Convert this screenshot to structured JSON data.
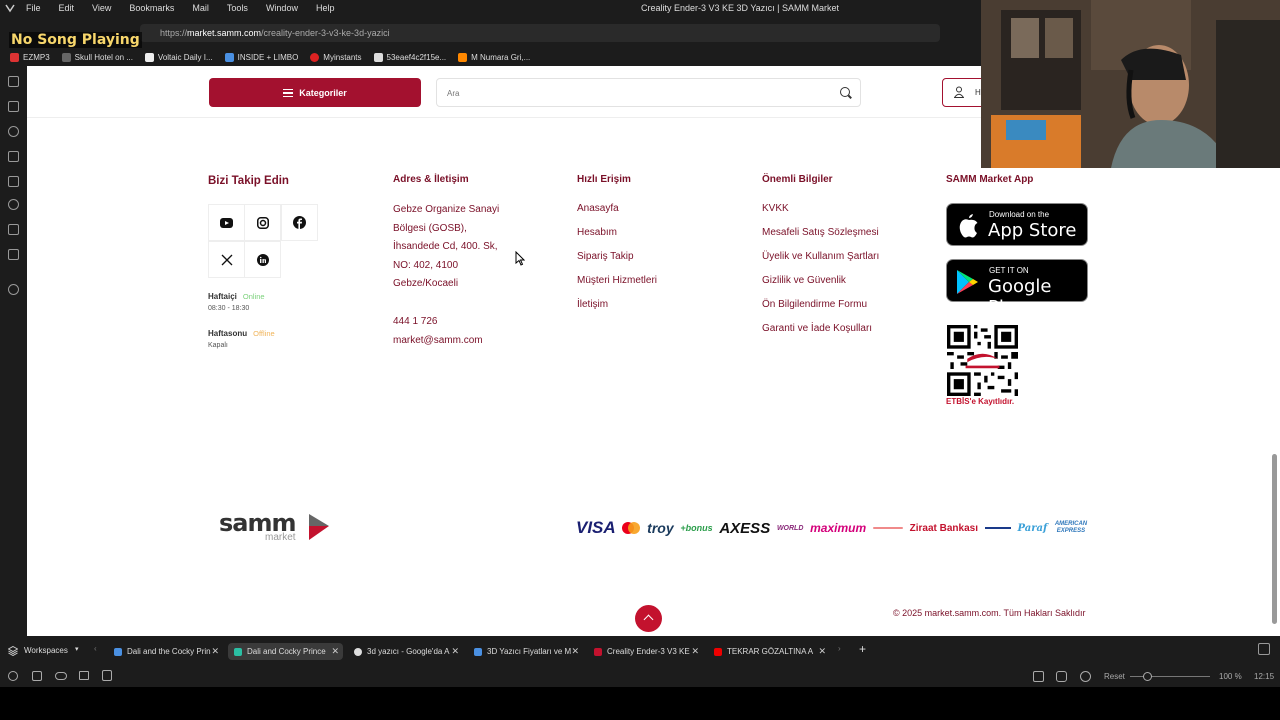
{
  "menubar": {
    "items": [
      "File",
      "Edit",
      "View",
      "Bookmarks",
      "Mail",
      "Tools",
      "Window",
      "Help"
    ],
    "window_title": "Creality Ender-3 V3 KE 3D Yazıcı | SAMM Market"
  },
  "overlay": {
    "now_playing": "No Song Playing"
  },
  "address": {
    "url_prefix": "https://",
    "url_host": "market.samm.com",
    "url_path": "/creality-ender-3-v3-ke-3d-yazici"
  },
  "bookmarks": [
    {
      "label": "EZMP3",
      "color": "#d33"
    },
    {
      "label": "Skull Hotel on ...",
      "color": "#333"
    },
    {
      "label": "Voltaic Daily I...",
      "color": "#fff"
    },
    {
      "label": "INSIDE + LIMBO",
      "color": "#4a90e2"
    },
    {
      "label": "Myinstants",
      "color": "#d22"
    },
    {
      "label": "53eaef4c2f15e...",
      "color": "#ddd"
    },
    {
      "label": "M Numara Gri,...",
      "color": "#f80"
    }
  ],
  "header": {
    "categories_label": "Kategoriler",
    "search_placeholder": "Ara",
    "login_label": "H"
  },
  "footer": {
    "follow_title": "Bizi Takip Edin",
    "social": [
      "youtube-icon",
      "instagram-icon",
      "facebook-icon",
      "x-icon",
      "linkedin-icon"
    ],
    "weekday_label": "Haftaiçi",
    "weekday_status": "Online",
    "weekday_hours": "08:30 - 18:30",
    "weekend_label": "Haftasonu",
    "weekend_status": "Offline",
    "weekend_hours": "Kapalı",
    "address_title": "Adres & İletişim",
    "address_lines": [
      "Gebze Organize Sanayi",
      "Bölgesi (GOSB),",
      "İhsandede Cd, 400. Sk,",
      "NO: 402, 4100",
      "Gebze/Kocaeli"
    ],
    "phone": "444 1 726",
    "email": "market@samm.com",
    "quick_title": "Hızlı Erişim",
    "quick_links": [
      "Anasayfa",
      "Hesabım",
      "Sipariş Takip",
      "Müşteri Hizmetleri",
      "İletişim"
    ],
    "info_title": "Önemli Bilgiler",
    "info_links": [
      "KVKK",
      "Mesafeli Satış Sözleşmesi",
      "Üyelik ve Kullanım Şartları",
      "Gizlilik ve Güvenlik",
      "Ön Bilgilendirme Formu",
      "Garanti ve İade Koşulları"
    ],
    "app_title": "SAMM Market App",
    "appstore_small": "Download on the",
    "appstore_big": "App Store",
    "googleplay_small": "GET IT ON",
    "googleplay_big": "Google Play",
    "etbis_label": "ETBİS'e Kayıtlıdır.",
    "logo_word": "samm",
    "logo_sub": "market",
    "payments": [
      "VISA",
      "troy",
      "+bonus",
      "AXESS",
      "WORLD",
      "maximum",
      "Ziraat Bankası",
      "Paraf",
      "AMERICAN EXPRESS"
    ],
    "copyright": "© 2025 market.samm.com. Tüm Hakları Saklıdır"
  },
  "tabs": {
    "workspaces": "Workspaces",
    "items": [
      {
        "label": "Dali and the Cocky Prin",
        "color": "#4a90e2",
        "active": false
      },
      {
        "label": "Dali and Cocky Prince",
        "color": "#2bbfa4",
        "active": true
      },
      {
        "label": "3d yazıcı - Google'da A",
        "color": "#ddd",
        "active": false
      },
      {
        "label": "3D Yazıcı Fiyatları ve M",
        "color": "#4a90e2",
        "active": false
      },
      {
        "label": "Creality Ender-3 V3 KE",
        "color": "#c3122e",
        "active": false
      },
      {
        "label": "TEKRAR GÖZALTINA A",
        "color": "#e00",
        "active": false
      }
    ]
  },
  "status": {
    "reset_label": "Reset",
    "zoom": "100 %",
    "time": "12:15"
  },
  "colors": {
    "brand": "#a3112f",
    "brand_text": "#7a1028",
    "online": "#7bd17b",
    "offline": "#f0b45a"
  }
}
